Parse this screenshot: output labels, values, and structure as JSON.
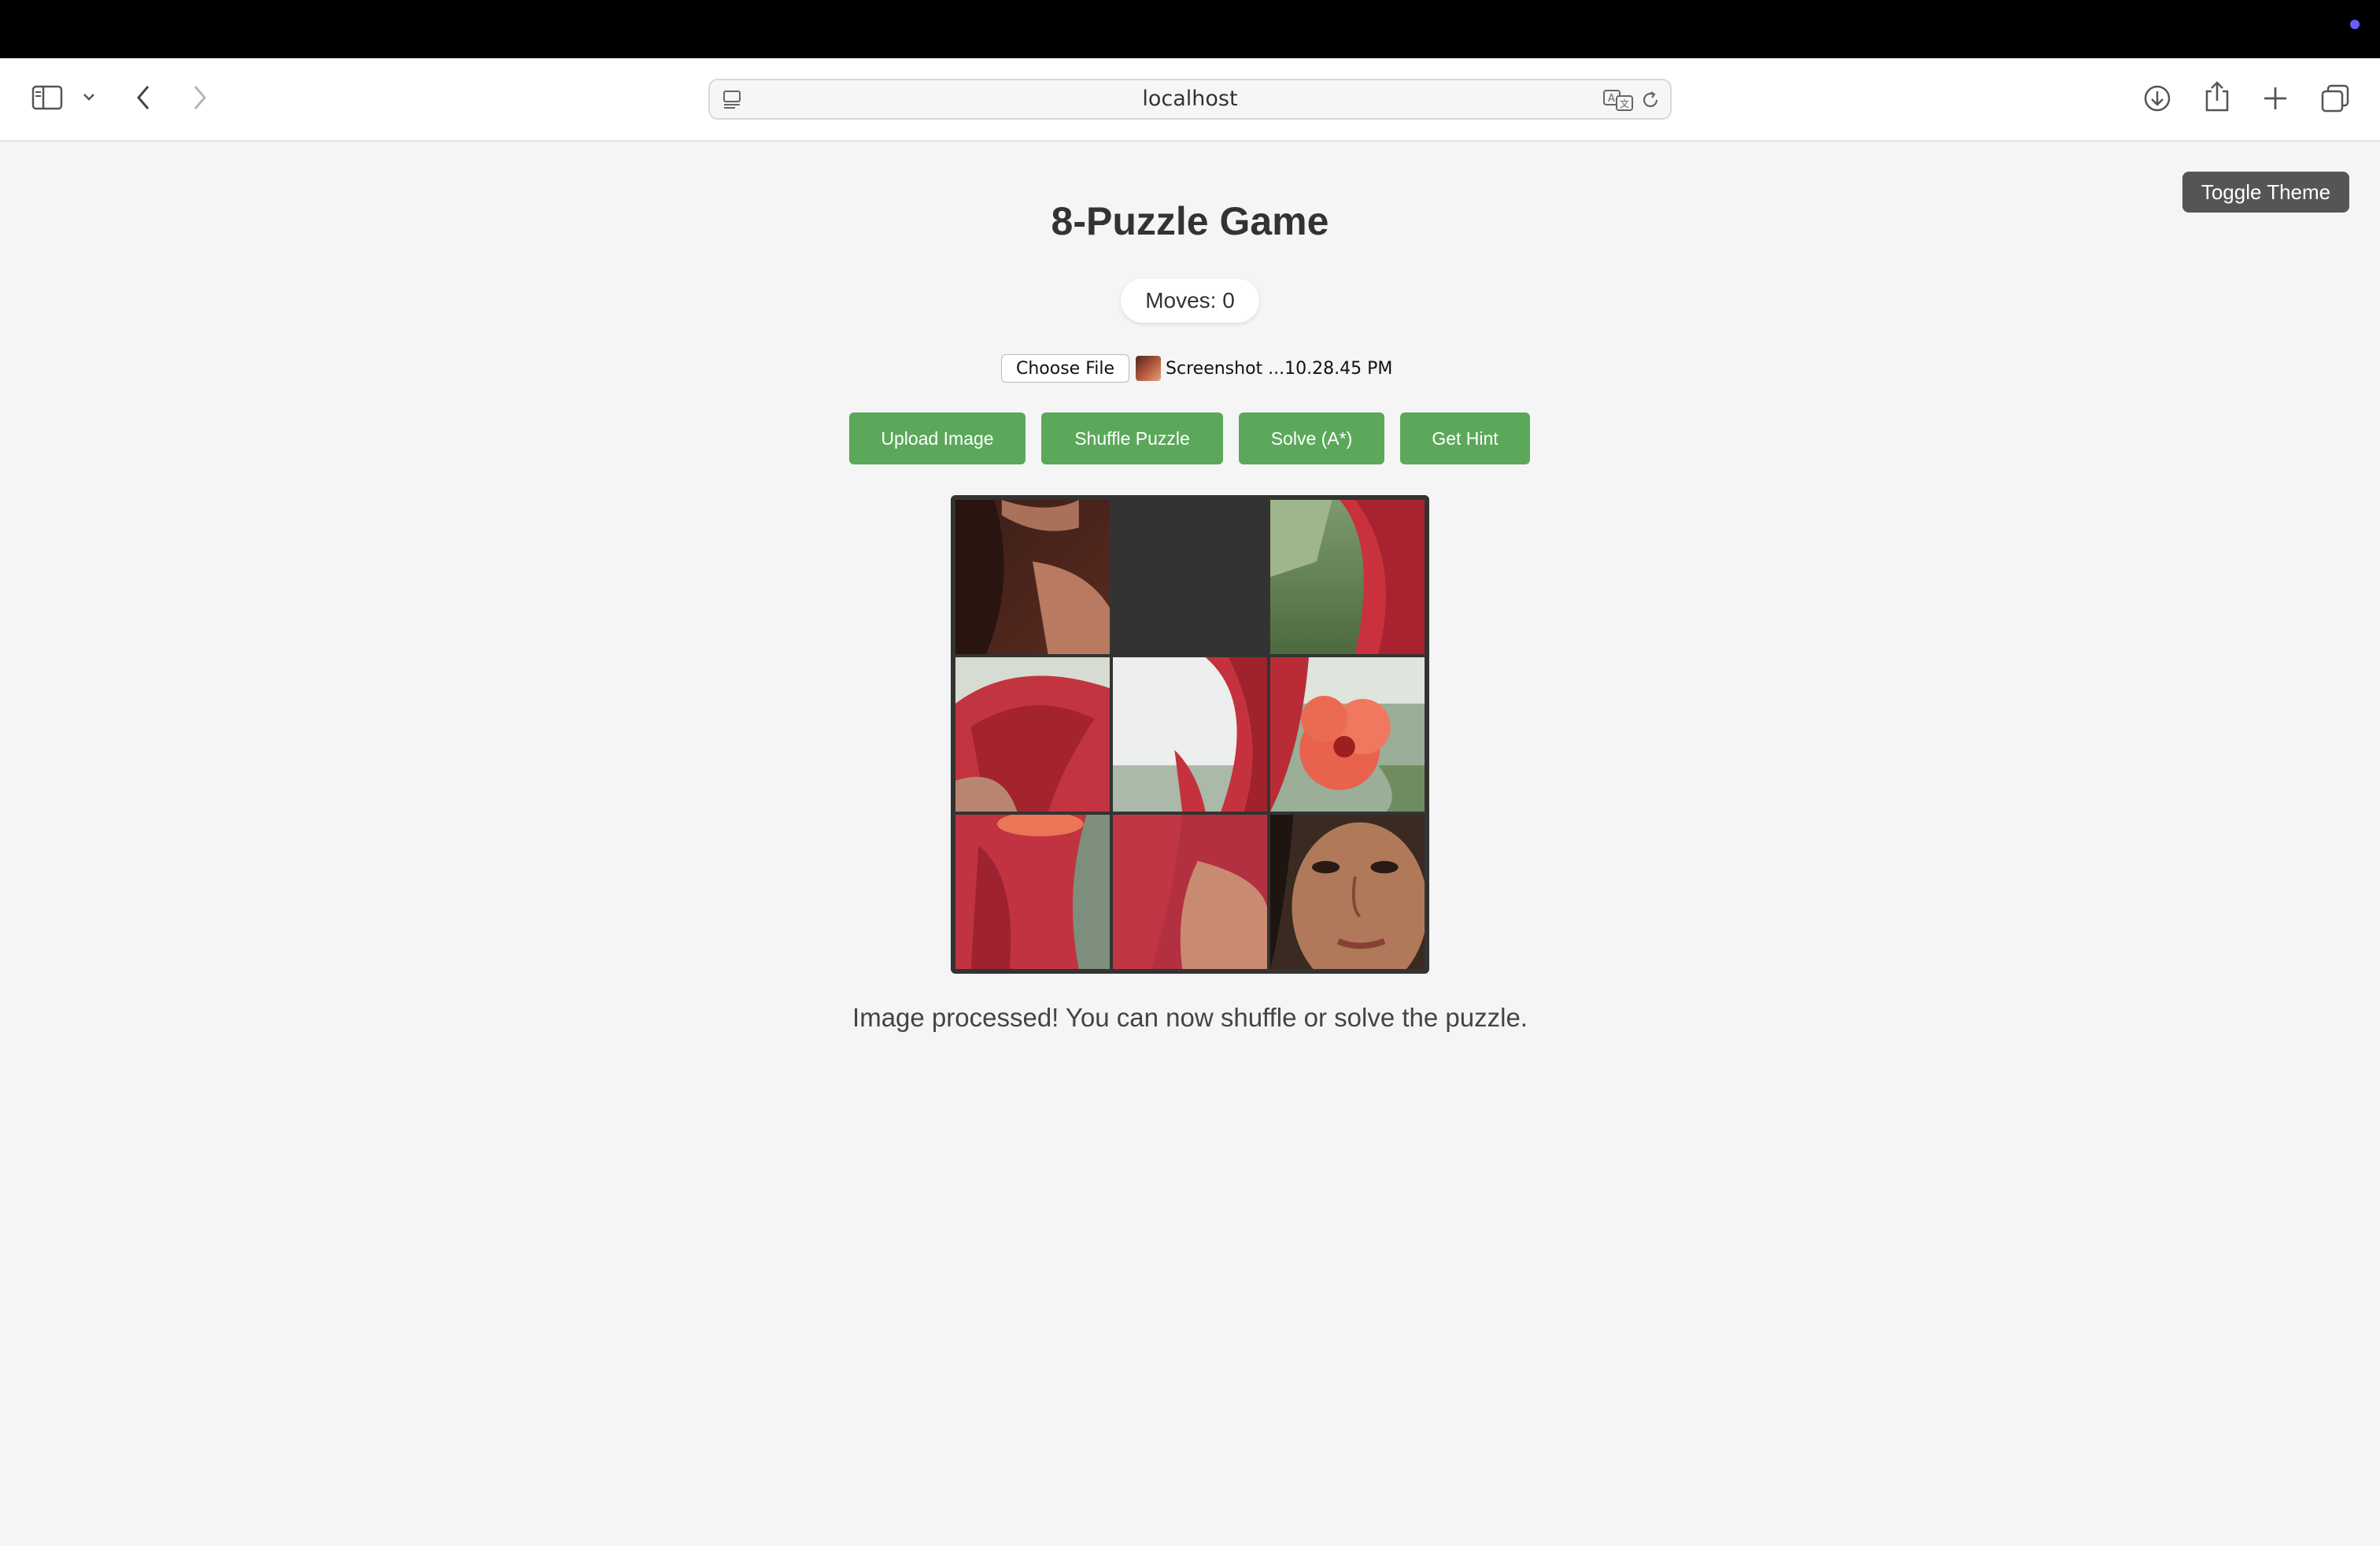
{
  "browser": {
    "url": "localhost"
  },
  "page": {
    "toggle_theme_label": "Toggle Theme",
    "title": "8-Puzzle Game",
    "moves_label": "Moves: 0",
    "file_input": {
      "button_label": "Choose File",
      "file_name": "Screenshot ...10.28.45 PM"
    },
    "buttons": {
      "upload": "Upload Image",
      "shuffle": "Shuffle Puzzle",
      "solve": "Solve (A*)",
      "hint": "Get Hint"
    },
    "status": "Image processed! You can now shuffle or solve the puzzle."
  },
  "board": {
    "empty_position": 1,
    "tiles": [
      {
        "name": "tile-shoulder-chin",
        "desc_icon": "image-piece"
      },
      {
        "name": "tile-empty",
        "desc_icon": "empty"
      },
      {
        "name": "tile-hair-landscape-right",
        "desc_icon": "image-piece"
      },
      {
        "name": "tile-hair-top",
        "desc_icon": "image-piece"
      },
      {
        "name": "tile-hair-sky",
        "desc_icon": "image-piece"
      },
      {
        "name": "tile-flower",
        "desc_icon": "image-piece"
      },
      {
        "name": "tile-hair-flower-bottom",
        "desc_icon": "image-piece"
      },
      {
        "name": "tile-hair-shoulder",
        "desc_icon": "image-piece"
      },
      {
        "name": "tile-face",
        "desc_icon": "image-piece"
      }
    ]
  },
  "colors": {
    "accent_green": "#5ba85b",
    "dark_button": "#555555",
    "board_bg": "#333333"
  }
}
